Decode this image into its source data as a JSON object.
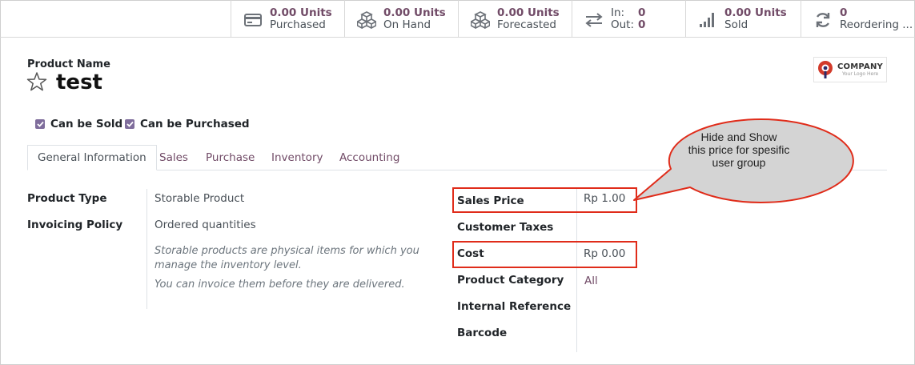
{
  "smart_buttons": {
    "purchased": {
      "value": "0.00 Units",
      "label": "Purchased",
      "icon": "credit-card-icon"
    },
    "on_hand": {
      "value": "0.00 Units",
      "label": "On Hand",
      "icon": "cubes-icon"
    },
    "forecasted": {
      "value": "0.00 Units",
      "label": "Forecasted",
      "icon": "cubes-icon"
    },
    "in_out": {
      "in_label": "In:",
      "in_value": "0",
      "out_label": "Out:",
      "out_value": "0",
      "icon": "exchange-arrows-icon"
    },
    "sold": {
      "value": "0.00 Units",
      "label": "Sold",
      "icon": "bar-chart-icon"
    },
    "reordering": {
      "value": "0",
      "label": "Reordering ...",
      "icon": "refresh-icon"
    }
  },
  "product": {
    "name_label": "Product Name",
    "name": "test",
    "can_be_sold": "Can be Sold",
    "can_be_purchased": "Can be Purchased"
  },
  "logo": {
    "line1": "COMPANY",
    "line2": "Your Logo Here"
  },
  "tabs": [
    "General Information",
    "Sales",
    "Purchase",
    "Inventory",
    "Accounting"
  ],
  "general": {
    "product_type_label": "Product Type",
    "product_type": "Storable Product",
    "invoicing_policy_label": "Invoicing Policy",
    "invoicing_policy": "Ordered quantities",
    "help1": "Storable products are physical items for which you",
    "help2": "manage the inventory level.",
    "help3": "You can invoice them before they are delivered.",
    "sales_price_label": "Sales Price",
    "sales_price": "Rp 1.00",
    "customer_taxes_label": "Customer Taxes",
    "cost_label": "Cost",
    "cost": "Rp 0.00",
    "product_category_label": "Product Category",
    "product_category": "All",
    "internal_reference_label": "Internal Reference",
    "barcode_label": "Barcode"
  },
  "annotation": {
    "line1": "Hide and Show",
    "line2": "this price for spesific",
    "line3": "user group"
  },
  "colors": {
    "accent": "#714b67",
    "annotation_red": "#e02c1a",
    "callout_fill": "#d4d4d4"
  }
}
